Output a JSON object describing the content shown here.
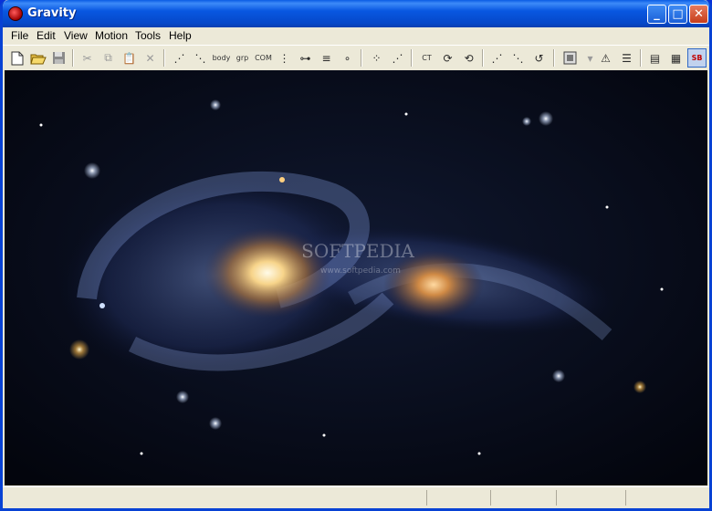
{
  "window": {
    "title": "Gravity"
  },
  "title_buttons": {
    "minimize": "_",
    "maximize": "□",
    "close": "✕"
  },
  "menu": [
    "File",
    "Edit",
    "View",
    "Motion",
    "Tools",
    "Help"
  ],
  "toolbar": {
    "body_label": "body",
    "grp_label": "grp",
    "com_label": "COM",
    "ct_label": "CT",
    "sb_label": "SB"
  },
  "canvas": {
    "watermark_main": "SOFTPEDIA",
    "watermark_sub": "www.softpedia.com"
  }
}
